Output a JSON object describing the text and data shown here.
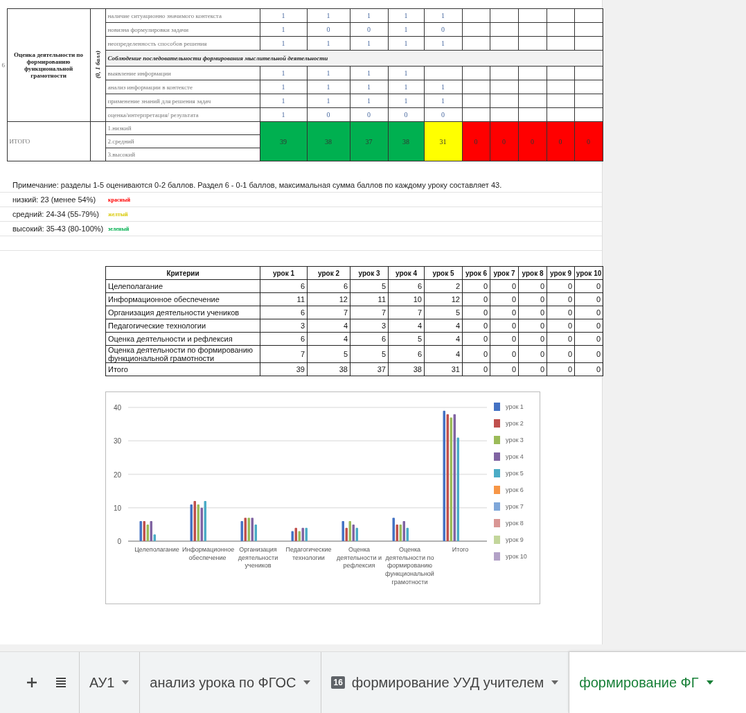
{
  "top_table": {
    "row_number": "6",
    "section_title": "Оценка деятельности по формированию функциональной грамотности",
    "score_range": "(0, 1 балл)",
    "rows": [
      {
        "kind": "item",
        "criterion": "наличие ситуационно значимого контекста",
        "values": [
          "1",
          "1",
          "1",
          "1",
          "1"
        ]
      },
      {
        "kind": "item",
        "criterion": "новизна формулировки задачи",
        "values": [
          "1",
          "0",
          "0",
          "1",
          "0"
        ]
      },
      {
        "kind": "item",
        "criterion": "неопределенность способов решения",
        "values": [
          "1",
          "1",
          "1",
          "1",
          "1"
        ]
      },
      {
        "kind": "heading",
        "criterion": "Соблюдение последовательности формирования мыслительной деятельности"
      },
      {
        "kind": "item",
        "criterion": "выявление информации",
        "values": [
          "1",
          "1",
          "1",
          "1"
        ]
      },
      {
        "kind": "item",
        "criterion": "анализ информации в контексте",
        "values": [
          "1",
          "1",
          "1",
          "1",
          "1"
        ]
      },
      {
        "kind": "item",
        "criterion": "применение знаний для решения задач",
        "values": [
          "1",
          "1",
          "1",
          "1",
          "1"
        ]
      },
      {
        "kind": "item",
        "criterion": "оценка/интерпретация/ результата",
        "values": [
          "1",
          "0",
          "0",
          "0",
          "0"
        ]
      }
    ],
    "total": {
      "label": "ИТОГО",
      "levels": [
        "1.низкий",
        "2.средний",
        "3.высокий"
      ],
      "cells": [
        {
          "value": "39",
          "color": "#00b050"
        },
        {
          "value": "38",
          "color": "#00b050"
        },
        {
          "value": "37",
          "color": "#00b050"
        },
        {
          "value": "38",
          "color": "#00b050"
        },
        {
          "value": "31",
          "color": "#ffff00"
        },
        {
          "value": "0",
          "color": "#ff0000"
        },
        {
          "value": "0",
          "color": "#ff0000"
        },
        {
          "value": "0",
          "color": "#ff0000"
        },
        {
          "value": "0",
          "color": "#ff0000"
        },
        {
          "value": "0",
          "color": "#ff0000"
        }
      ]
    }
  },
  "note": "Примечание: разделы 1-5 оцениваются 0-2 баллов. Раздел 6 - 0-1 баллов, максимальная сумма баллов по каждому уроку составляет 43.",
  "levels": [
    {
      "label": "низкий: 23 (менее 54%)",
      "color_word": "красный",
      "color": "#ff0000"
    },
    {
      "label": "средний: 24-34 (55-79%)",
      "color_word": "желтый",
      "color": "#d8c800"
    },
    {
      "label": "высокий: 35-43 (80-100%)",
      "color_word": "зеленый",
      "color": "#00b050"
    }
  ],
  "summary_table": {
    "columns": [
      "Критерии",
      "урок 1",
      "урок 2",
      "урок 3",
      "урок 4",
      "урок 5",
      "урок 6",
      "урок 7",
      "урок 8",
      "урок 9",
      "урок 10"
    ],
    "rows": [
      {
        "criterion": "Целеполагание",
        "values": [
          "6",
          "6",
          "5",
          "6",
          "2",
          "0",
          "0",
          "0",
          "0",
          "0"
        ]
      },
      {
        "criterion": "Информационное обеспечение",
        "values": [
          "11",
          "12",
          "11",
          "10",
          "12",
          "0",
          "0",
          "0",
          "0",
          "0"
        ]
      },
      {
        "criterion": "Организация деятельности учеников",
        "values": [
          "6",
          "7",
          "7",
          "7",
          "5",
          "0",
          "0",
          "0",
          "0",
          "0"
        ]
      },
      {
        "criterion": "Педагогические технологии",
        "values": [
          "3",
          "4",
          "3",
          "4",
          "4",
          "0",
          "0",
          "0",
          "0",
          "0"
        ]
      },
      {
        "criterion": "Оценка деятельности и рефлексия",
        "values": [
          "6",
          "4",
          "6",
          "5",
          "4",
          "0",
          "0",
          "0",
          "0",
          "0"
        ]
      },
      {
        "criterion": "Оценка деятельности по формированию функциональной грамотности",
        "values": [
          "7",
          "5",
          "5",
          "6",
          "4",
          "0",
          "0",
          "0",
          "0",
          "0"
        ]
      },
      {
        "criterion": "Итого",
        "values": [
          "39",
          "38",
          "37",
          "38",
          "31",
          "0",
          "0",
          "0",
          "0",
          "0"
        ]
      }
    ]
  },
  "chart": {
    "chart_data": {
      "type": "bar",
      "categories": [
        "Целеполагание",
        "Информационное обеспечение",
        "Организация деятельности учеников",
        "Педагогические технологии",
        "Оценка деятельности и рефлексия",
        "Оценка деятельности по формированию функциональной грамотности",
        "Итого"
      ],
      "ylim": [
        0,
        40
      ],
      "grid": true,
      "legend": "right",
      "yticks": [
        0,
        10,
        20,
        30,
        40
      ],
      "series": [
        {
          "name": "урок 1",
          "color": "#4472c4",
          "values": [
            6,
            11,
            6,
            3,
            6,
            7,
            39
          ]
        },
        {
          "name": "урок 2",
          "color": "#c0504d",
          "values": [
            6,
            12,
            7,
            4,
            4,
            5,
            38
          ]
        },
        {
          "name": "урок 3",
          "color": "#9bbb59",
          "values": [
            5,
            11,
            7,
            3,
            6,
            5,
            37
          ]
        },
        {
          "name": "урок 4",
          "color": "#8064a2",
          "values": [
            6,
            10,
            7,
            4,
            5,
            6,
            38
          ]
        },
        {
          "name": "урок 5",
          "color": "#4bacc6",
          "values": [
            2,
            12,
            5,
            4,
            4,
            4,
            31
          ]
        },
        {
          "name": "урок 6",
          "color": "#f79646",
          "values": [
            0,
            0,
            0,
            0,
            0,
            0,
            0
          ]
        },
        {
          "name": "урок 7",
          "color": "#7fa7d9",
          "values": [
            0,
            0,
            0,
            0,
            0,
            0,
            0
          ]
        },
        {
          "name": "урок 8",
          "color": "#d99694",
          "values": [
            0,
            0,
            0,
            0,
            0,
            0,
            0
          ]
        },
        {
          "name": "урок 9",
          "color": "#c3d69b",
          "values": [
            0,
            0,
            0,
            0,
            0,
            0,
            0
          ]
        },
        {
          "name": "урок 10",
          "color": "#b3a2c7",
          "values": [
            0,
            0,
            0,
            0,
            0,
            0,
            0
          ]
        }
      ]
    }
  },
  "sheet_tabs": [
    {
      "label": "АУ1",
      "selected": false
    },
    {
      "label": "анализ урока по ФГОС",
      "selected": false
    },
    {
      "label": "формирование УУД учителем",
      "badge": "16",
      "selected": false
    },
    {
      "label": "формирование ФГ",
      "selected": true
    }
  ]
}
